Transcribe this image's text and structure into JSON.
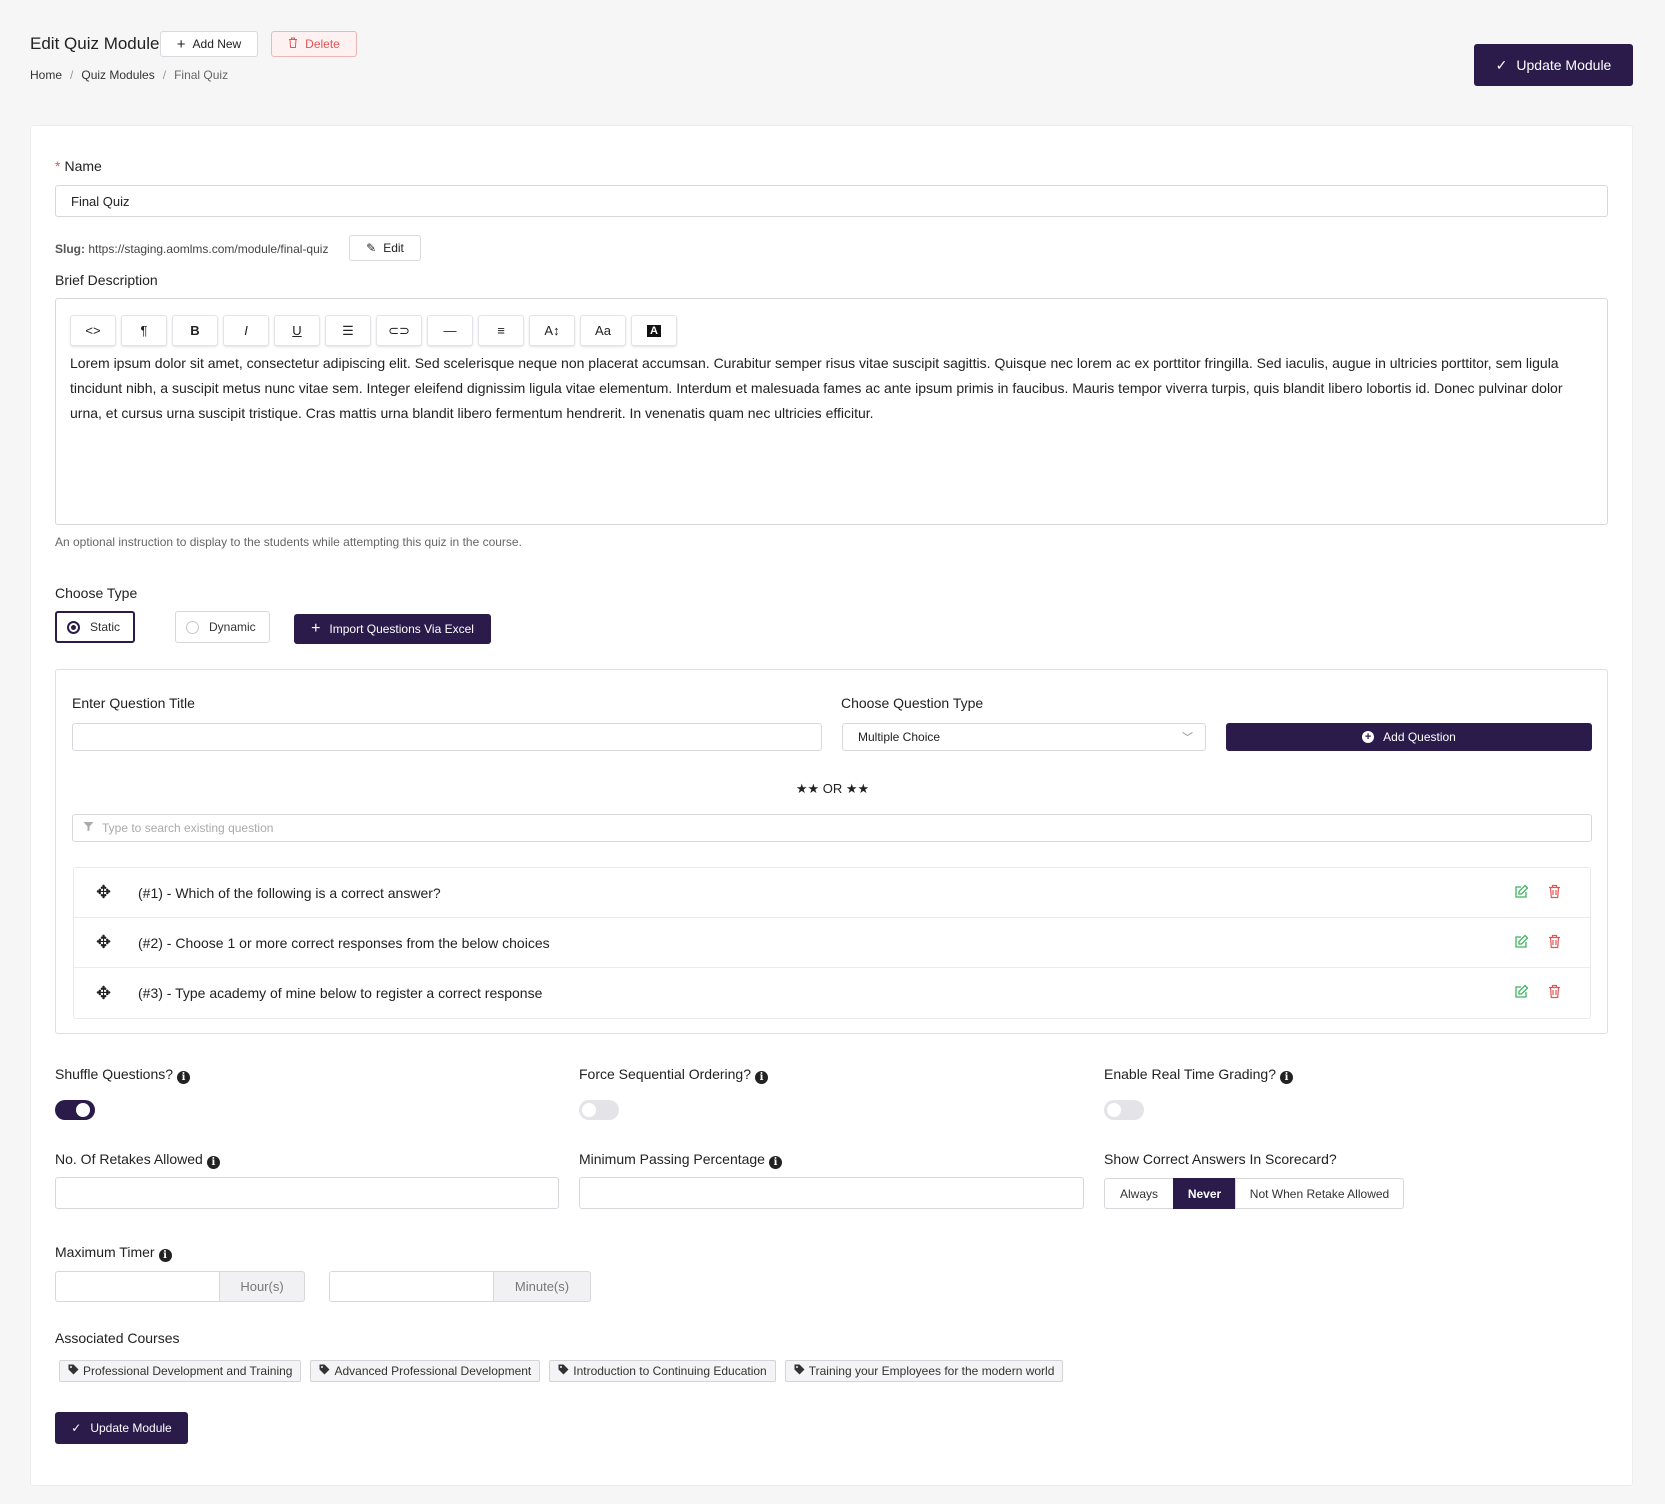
{
  "header": {
    "title": "Edit Quiz Module",
    "add_new_label": "Add New",
    "delete_label": "Delete",
    "update_label": "Update Module",
    "breadcrumb": [
      "Home",
      "Quiz Modules",
      "Final Quiz"
    ]
  },
  "form": {
    "name_label": "Name",
    "name_value": "Final Quiz",
    "slug_label": "Slug:",
    "slug_url": "https://staging.aomlms.com/module/final-quiz",
    "slug_edit_label": "Edit",
    "description_label": "Brief Description",
    "description_text": "Lorem ipsum dolor sit amet, consectetur adipiscing elit. Sed scelerisque neque non placerat accumsan. Curabitur semper risus vitae suscipit sagittis. Quisque nec lorem ac ex porttitor fringilla. Sed iaculis, augue in ultricies porttitor, sem ligula tincidunt nibh, a suscipit metus nunc vitae sem. Integer eleifend dignissim ligula vitae elementum. Interdum et malesuada fames ac ante ipsum primis in faucibus. Mauris tempor viverra turpis, quis blandit libero lobortis id. Donec pulvinar dolor urna, et cursus urna suscipit tristique. Cras mattis urna blandit libero fermentum hendrerit. In venenatis quam nec ultricies efficitur.",
    "description_hint": "An optional instruction to display to the students while attempting this quiz in the course.",
    "toolbar_icons": [
      "code-view-icon",
      "paragraph-icon",
      "bold-icon",
      "italic-icon",
      "underline-icon",
      "list-icon",
      "link-icon",
      "horizontal-rule-icon",
      "align-icon",
      "font-size-icon",
      "text-case-icon",
      "text-color-icon"
    ],
    "toolbar_glyphs": [
      "<>",
      "¶",
      "B",
      "I",
      "U",
      "☰",
      "⊂⊃",
      "—",
      "≡",
      "A↕",
      "Aa",
      "A"
    ],
    "choose_type_label": "Choose Type",
    "type_static": "Static",
    "type_dynamic": "Dynamic",
    "import_label": "Import Questions Via Excel"
  },
  "questions": {
    "title_label": "Enter Question Title",
    "title_value": "",
    "type_label": "Choose Question Type",
    "type_selected": "Multiple Choice",
    "add_label": "Add Question",
    "or_text": "★★ OR ★★",
    "search_placeholder": "Type to search existing question",
    "items": [
      "(#1) - Which of the following is a correct answer?",
      "(#2) - Choose 1 or more correct responses from the below choices",
      "(#3) - Type academy of mine below to register a correct response"
    ]
  },
  "settings": {
    "shuffle_label": "Shuffle Questions?",
    "shuffle_on": true,
    "sequential_label": "Force Sequential Ordering?",
    "sequential_on": false,
    "grading_label": "Enable Real Time Grading?",
    "grading_on": false,
    "retakes_label": "No. Of Retakes Allowed",
    "passing_label": "Minimum Passing Percentage",
    "show_answers_label": "Show Correct Answers In Scorecard?",
    "show_answers_options": [
      "Always",
      "Never",
      "Not When Retake Allowed"
    ],
    "show_answers_selected": "Never",
    "timer_label": "Maximum Timer",
    "hours_addon": "Hour(s)",
    "minutes_addon": "Minute(s)",
    "courses_label": "Associated Courses",
    "courses": [
      "Professional Development and Training",
      "Advanced Professional Development",
      "Introduction to Continuing Education",
      "Training your Employees for the modern world"
    ],
    "update_label": "Update Module"
  },
  "colors": {
    "primary": "#2a1b4b",
    "danger": "#e05656",
    "success": "#3cb55e"
  }
}
